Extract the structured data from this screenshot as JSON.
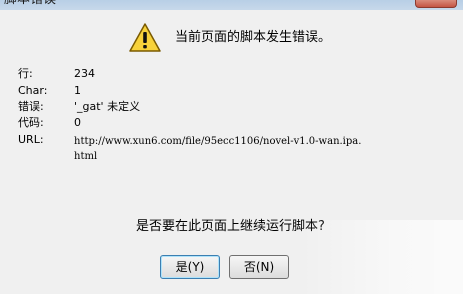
{
  "window": {
    "title": "脚本错误"
  },
  "header": {
    "message": "当前页面的脚本发生错误。"
  },
  "details": [
    {
      "label": "行:",
      "value": "234"
    },
    {
      "label": "Char:",
      "value": "1"
    },
    {
      "label": "错误:",
      "value": "'_gat' 未定义"
    },
    {
      "label": "代码:",
      "value": "0"
    },
    {
      "label": "URL:",
      "value": "http://www.xun6.com/file/95ecc1106/novel-v1.0-wan.ipa.html"
    }
  ],
  "question": "是否要在此页面上继续运行脚本?",
  "buttons": {
    "yes": "是(Y)",
    "no": "否(N)"
  },
  "icons": {
    "warning": "warning-triangle-icon",
    "close": "close-icon"
  },
  "colors": {
    "dialog_bg": "#f0f0f0",
    "warning_yellow": "#f7d23b",
    "default_button_border": "#3c7fb1"
  }
}
